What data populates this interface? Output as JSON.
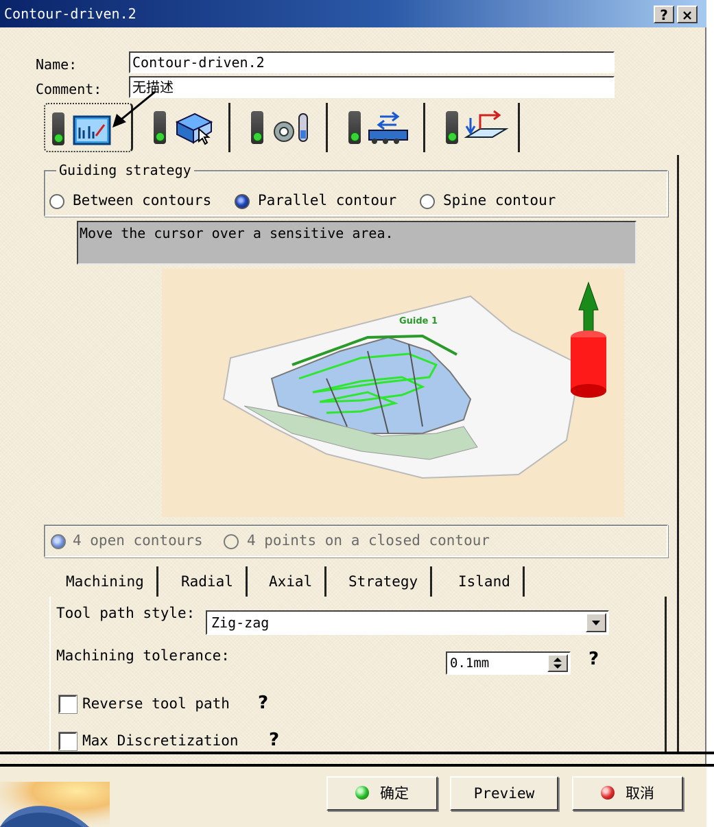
{
  "window": {
    "title": "Contour-driven.2",
    "help_btn": "?",
    "close_btn": "×"
  },
  "form": {
    "name_label": "Name:",
    "name_value": "Contour-driven.2",
    "comment_label": "Comment:",
    "comment_value": "无描述"
  },
  "icon_tabs": [
    "geometry-tab-icon",
    "tool-tab-icon",
    "feeds-speeds-tab-icon",
    "macro-tab-icon",
    "strategy-tab-icon"
  ],
  "guiding": {
    "title": "Guiding strategy",
    "options": [
      "Between contours",
      "Parallel contour",
      "Spine contour"
    ],
    "selected": "Parallel contour"
  },
  "hint": "Move the cursor over a sensitive area.",
  "figure": {
    "guide_label": "Guide 1"
  },
  "contours": {
    "options": [
      "4 open contours",
      "4 points on a closed contour"
    ],
    "selected": "4 open contours"
  },
  "subtabs": [
    "Machining",
    "Radial",
    "Axial",
    "Strategy",
    "Island"
  ],
  "machining": {
    "tool_path_style_label": "Tool path style:",
    "tool_path_style_value": "Zig-zag",
    "tolerance_label": "Machining tolerance:",
    "tolerance_value": "0.1mm",
    "reverse_label": "Reverse tool path",
    "reverse_checked": false,
    "max_disc_label": "Max Discretization",
    "max_disc_checked": false,
    "help": "?"
  },
  "buttons": {
    "ok": "确定",
    "preview": "Preview",
    "cancel": "取消"
  },
  "colors": {
    "title_start": "#0a246a",
    "title_end": "#a6caf0",
    "face": "#f3ecd9",
    "surface_blue": "#a9c8ec",
    "path_green": "#2ee62e"
  }
}
